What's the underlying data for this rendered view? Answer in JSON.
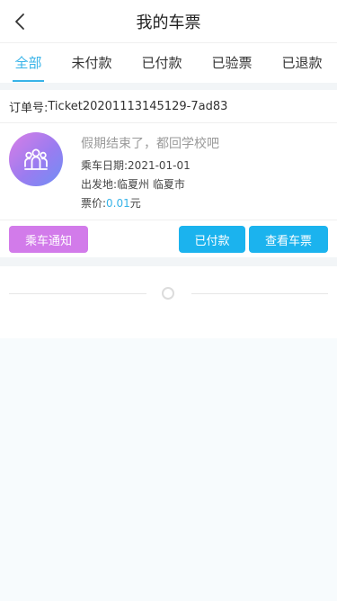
{
  "header": {
    "title": "我的车票"
  },
  "tabs": [
    {
      "label": "全部",
      "active": true
    },
    {
      "label": "未付款",
      "active": false
    },
    {
      "label": "已付款",
      "active": false
    },
    {
      "label": "已验票",
      "active": false
    },
    {
      "label": "已退款",
      "active": false
    }
  ],
  "order": {
    "order_label": "订单号:",
    "order_number": "Ticket20201113145129-7ad83",
    "trip_title": "假期结束了，都回学校吧",
    "date_label": "乘车日期:",
    "date_value": "2021-01-01",
    "departure_label": "出发地:",
    "departure_value": "临夏州 临夏市",
    "price_label": "票价:",
    "price_value": "0.01",
    "price_unit": "元",
    "notice_button": "乘车通知",
    "status_button": "已付款",
    "view_button": "查看车票"
  },
  "colors": {
    "accent": "#37b3e8",
    "button_blue": "#1bb3ee",
    "button_purple": "#d27bea"
  },
  "icons": {
    "back": "chevron-left-icon",
    "group": "group-icon"
  }
}
